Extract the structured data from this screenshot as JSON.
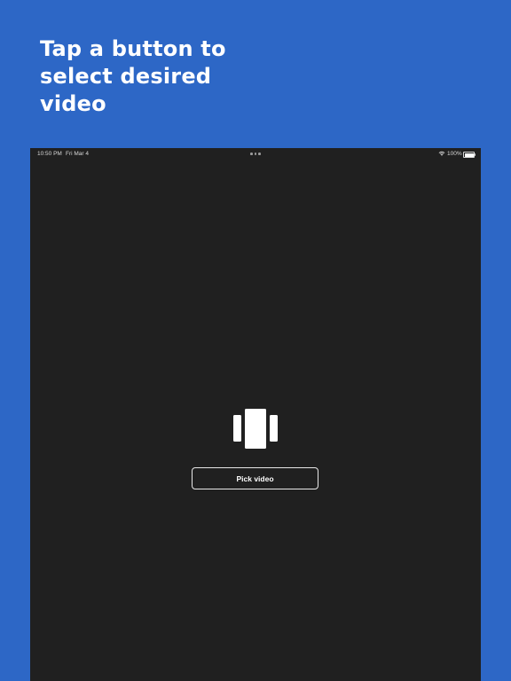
{
  "headline": "Tap a button to select desired video",
  "colors": {
    "background": "#2d67c6",
    "device_screen": "#202020",
    "text": "#ffffff",
    "button_border": "#e8e8e8"
  },
  "status_bar": {
    "time": "10:50 PM",
    "date": "Fri Mar 4",
    "battery": "100%",
    "icons": [
      "multitask-dots-icon",
      "wifi-icon",
      "battery-icon"
    ]
  },
  "main": {
    "icon": "video-carousel-icon",
    "button_label": "Pick video"
  }
}
